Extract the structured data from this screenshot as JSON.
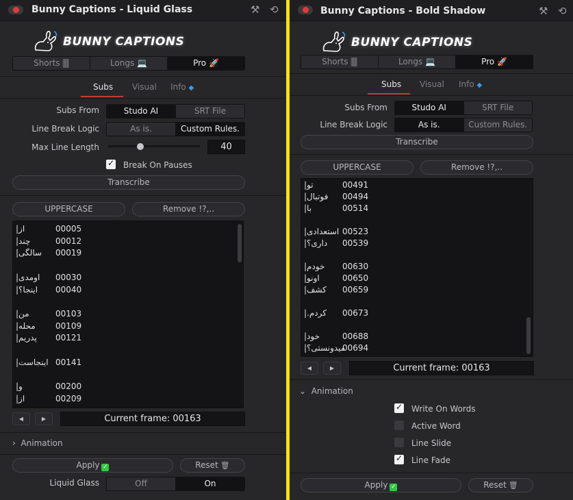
{
  "panels": [
    {
      "title": "Bunny Captions - Liquid Glass",
      "logo_text": "BUNNY CAPTIONS",
      "modes": [
        {
          "label": "Shorts",
          "icon": "🀫",
          "active": false
        },
        {
          "label": "Longs",
          "icon": "💻",
          "active": false
        },
        {
          "label": "Pro",
          "icon": "🚀",
          "active": true
        }
      ],
      "tabs": [
        {
          "label": "Subs",
          "active": true
        },
        {
          "label": "Visual",
          "active": false
        },
        {
          "label": "Info",
          "active": false
        }
      ],
      "subs_from_label": "Subs From",
      "subs_from_options": [
        "Studo AI",
        "SRT File"
      ],
      "line_break_label": "Line Break Logic",
      "line_break_options": [
        "As is.",
        "Custom Rules."
      ],
      "max_line_label": "Max Line Length",
      "max_line_value": "40",
      "max_line_slider_fraction": 0.35,
      "break_pauses_label": "Break On Pauses",
      "break_pauses_checked": true,
      "transcribe_label": "Transcribe",
      "uppercase_label": "UPPERCASE",
      "remove_label": "Remove !?,..",
      "subtitles": [
        {
          "word": "از|",
          "frame": "00005"
        },
        {
          "word": "چند|",
          "frame": "00012"
        },
        {
          "word": "سالگی|",
          "frame": "00019"
        },
        {
          "word": "",
          "frame": ""
        },
        {
          "word": "اومدی|",
          "frame": "00030"
        },
        {
          "word": "اینجا؟|",
          "frame": "00040"
        },
        {
          "word": "",
          "frame": ""
        },
        {
          "word": "من|",
          "frame": "00103"
        },
        {
          "word": "محله|",
          "frame": "00109"
        },
        {
          "word": "پدریم|",
          "frame": "00121"
        },
        {
          "word": "",
          "frame": ""
        },
        {
          "word": "اینجاست|",
          "frame": "00141"
        },
        {
          "word": "",
          "frame": ""
        },
        {
          "word": "و|",
          "frame": "00200"
        },
        {
          "word": "از|",
          "frame": "00209"
        }
      ],
      "current_frame": "Current frame: 00163",
      "animation_label": "Animation",
      "apply_label": "Apply",
      "reset_label": "Reset",
      "liquid_glass_label": "Liquid Glass",
      "liquid_glass_options": [
        "Off",
        "On"
      ]
    },
    {
      "title": "Bunny Captions - Bold Shadow",
      "logo_text": "BUNNY CAPTIONS",
      "modes": [
        {
          "label": "Shorts",
          "icon": "🀫",
          "active": false
        },
        {
          "label": "Longs",
          "icon": "💻",
          "active": false
        },
        {
          "label": "Pro",
          "icon": "🚀",
          "active": true
        }
      ],
      "tabs": [
        {
          "label": "Subs",
          "active": true
        },
        {
          "label": "Visual",
          "active": false
        },
        {
          "label": "Info",
          "active": false
        }
      ],
      "subs_from_label": "Subs From",
      "subs_from_options": [
        "Studo AI",
        "SRT File"
      ],
      "line_break_label": "Line Break Logic",
      "line_break_options": [
        "As is.",
        "Custom Rules."
      ],
      "transcribe_label": "Transcribe",
      "uppercase_label": "UPPERCASE",
      "remove_label": "Remove !?,..",
      "subtitles": [
        {
          "word": "تو|",
          "frame": "00491"
        },
        {
          "word": "فوتبال|",
          "frame": "00494"
        },
        {
          "word": "با|",
          "frame": "00514"
        },
        {
          "word": "",
          "frame": ""
        },
        {
          "word": "استعدادی|",
          "frame": "00523"
        },
        {
          "word": "داری؟|",
          "frame": "00539"
        },
        {
          "word": "",
          "frame": ""
        },
        {
          "word": "خودم|",
          "frame": "00630"
        },
        {
          "word": "اونو|",
          "frame": "00650"
        },
        {
          "word": "کشف|",
          "frame": "00659"
        },
        {
          "word": "",
          "frame": ""
        },
        {
          "word": "کردم.|",
          "frame": "00673"
        },
        {
          "word": "",
          "frame": ""
        },
        {
          "word": "خود|",
          "frame": "00688"
        },
        {
          "word": "میدونستی؟|",
          "frame": "00694"
        }
      ],
      "current_frame": "Current frame: 00163",
      "animation_label": "Animation",
      "animation_options": [
        {
          "label": "Write On Words",
          "checked": true
        },
        {
          "label": "Active Word",
          "checked": false
        },
        {
          "label": "Line Slide",
          "checked": false
        },
        {
          "label": "Line Fade",
          "checked": true
        }
      ],
      "apply_label": "Apply",
      "reset_label": "Reset"
    }
  ],
  "colors": {
    "divider": "#f7e016",
    "accent_red": "#c73b32",
    "record": "#e23b3b",
    "apply_check": "#2ecc40"
  }
}
